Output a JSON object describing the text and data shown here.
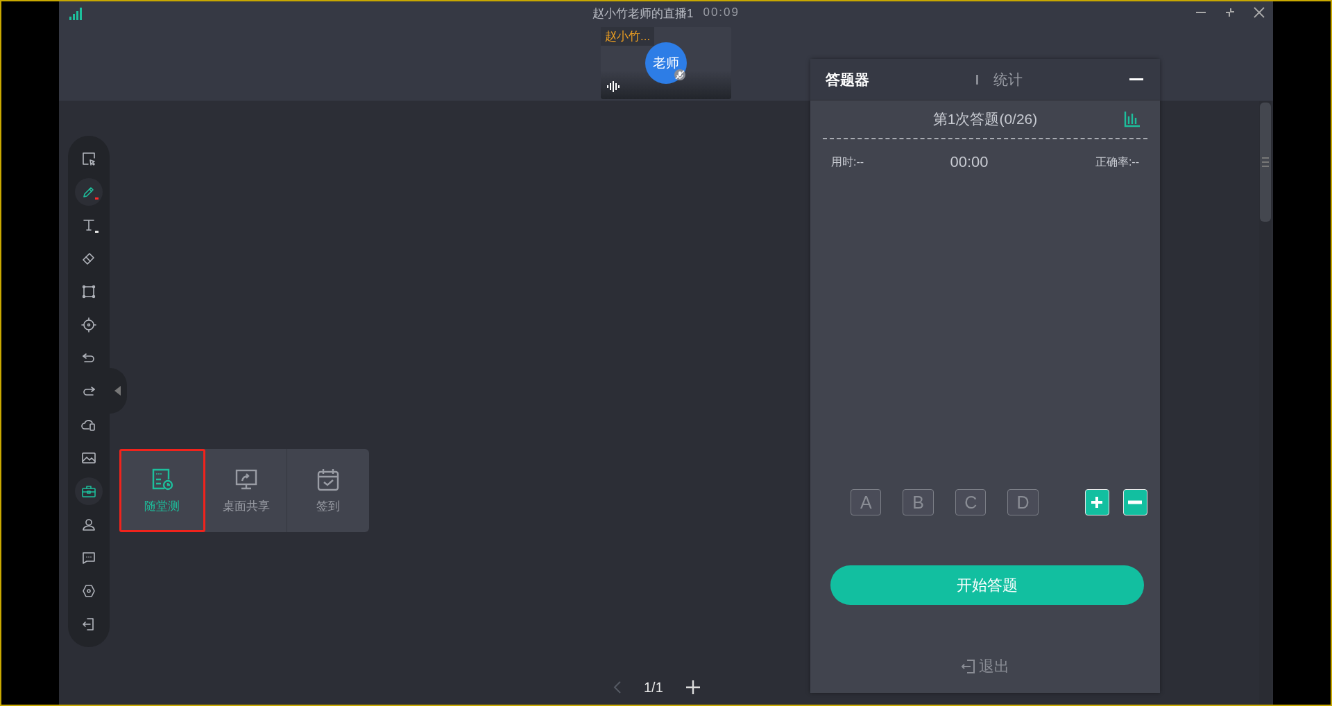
{
  "window": {
    "title": "赵小竹老师的直播1",
    "timer": "00:09"
  },
  "video_tile": {
    "name": "赵小竹...",
    "avatar_text": "老师",
    "mic_muted": true
  },
  "toolbar": {
    "tools": [
      {
        "kind": "select",
        "selected": false
      },
      {
        "kind": "pen",
        "selected": true,
        "color": "#ff2a2a"
      },
      {
        "kind": "text",
        "selected": false,
        "color": "#e6e6e6"
      },
      {
        "kind": "eraser",
        "selected": false
      },
      {
        "kind": "shape",
        "selected": false
      },
      {
        "kind": "laser",
        "selected": false
      },
      {
        "kind": "undo",
        "selected": false
      },
      {
        "kind": "redo",
        "selected": false
      },
      {
        "kind": "cloud",
        "selected": false
      },
      {
        "kind": "image",
        "selected": false
      },
      {
        "kind": "toolbox",
        "selected": true
      },
      {
        "kind": "user",
        "selected": false
      },
      {
        "kind": "chat",
        "selected": false
      },
      {
        "kind": "settings",
        "selected": false
      },
      {
        "kind": "exit",
        "selected": false
      }
    ]
  },
  "tool_popup": {
    "items": [
      {
        "kind": "quiz",
        "label": "随堂测",
        "selected": true
      },
      {
        "kind": "screen-share",
        "label": "桌面共享",
        "selected": false
      },
      {
        "kind": "check-in",
        "label": "签到",
        "selected": false
      }
    ]
  },
  "answer_panel": {
    "tabs": [
      {
        "label": "答题器",
        "selected": true
      },
      {
        "label": "统计",
        "selected": false
      }
    ],
    "round_title": "第1次答题(0/26)",
    "time_used": "用时:--",
    "timer": "00:00",
    "accuracy": "正确率:--",
    "options": [
      "A",
      "B",
      "C",
      "D"
    ],
    "start_button": "开始答题",
    "exit": "退出"
  },
  "pagination": {
    "page": "1/1"
  }
}
